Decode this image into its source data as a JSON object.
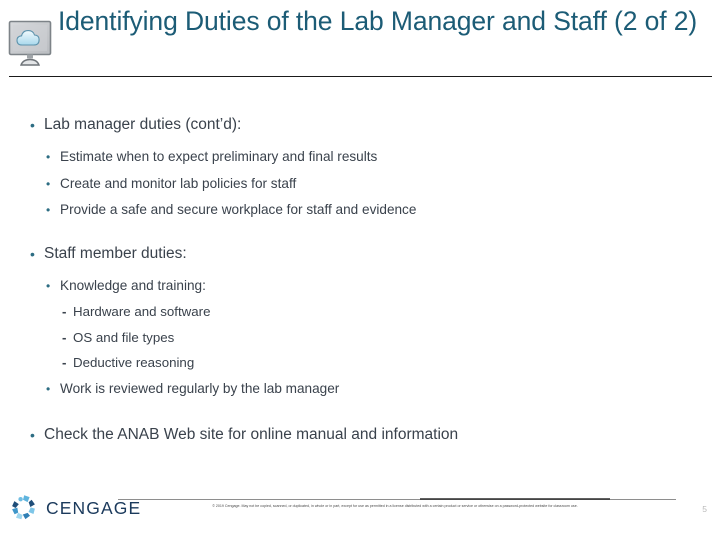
{
  "slide": {
    "title": "Identifying Duties of the Lab Manager and Staff (2 of 2)",
    "title_icon": "monitor-cloud-icon",
    "accent_color": "#1c5c76",
    "bullet_color": "#2d6d83",
    "body_color": "#3a424c",
    "page_number": "5"
  },
  "body": {
    "blocks": [
      {
        "level": 1,
        "marker": "•",
        "text": "Lab manager duties (cont’d):"
      },
      {
        "level": 2,
        "marker": "•",
        "text": "Estimate when to expect preliminary and final results"
      },
      {
        "level": 2,
        "marker": "•",
        "text": "Create and monitor lab policies for staff"
      },
      {
        "level": 2,
        "marker": "•",
        "text": "Provide a safe and secure workplace for staff and evidence"
      },
      {
        "level": 1,
        "marker": "•",
        "text": "Staff member duties:"
      },
      {
        "level": 2,
        "marker": "•",
        "text": "Knowledge and training:"
      },
      {
        "level": 3,
        "marker": "-",
        "text": "Hardware and software"
      },
      {
        "level": 3,
        "marker": "-",
        "text": "OS and file types"
      },
      {
        "level": 3,
        "marker": "-",
        "text": "Deductive reasoning"
      },
      {
        "level": 2,
        "marker": "•",
        "text": "Work is reviewed regularly by the lab manager"
      },
      {
        "level": 1,
        "marker": "•",
        "text": "Check the ANAB Web site for online manual and information"
      }
    ]
  },
  "footer": {
    "logo_mark": "cengage-swirl-logo",
    "logo_text": "CENGAGE",
    "copyright": "© 2019 Cengage. May not be copied, scanned, or duplicated, in whole or in part, except for use as permitted in a license distributed with a certain product or service or otherwise on a password-protected website for classroom use."
  }
}
